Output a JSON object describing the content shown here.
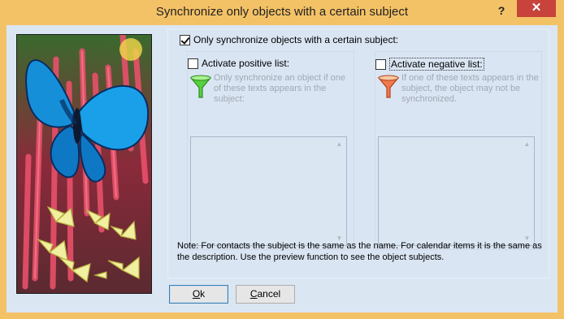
{
  "window": {
    "title": "Synchronize only objects with a certain subject",
    "help_label": "?",
    "close_label": "✕"
  },
  "main_option": {
    "label": "Only synchronize objects with a certain subject:",
    "checked": true
  },
  "positive": {
    "label": "Activate positive list:",
    "checked": false,
    "description": "Only synchronize an object if one of these texts appears in the subject:",
    "icon": "green-funnel-icon"
  },
  "negative": {
    "label": "Activate negative list:",
    "checked": false,
    "description": "If one of these texts appears in the subject, the object may not be synchronized.",
    "icon": "red-funnel-icon"
  },
  "note": "Note: For contacts the subject is the same as the name. For calendar items it is the same as the description.  Use the preview function to see the object subjects.",
  "buttons": {
    "ok_mnemonic": "O",
    "ok_rest": "k",
    "cancel_mnemonic": "C",
    "cancel_rest": "ancel"
  },
  "colors": {
    "title_bar": "#f4c266",
    "close_button": "#c7433b",
    "client_bg": "#dbe6f3"
  },
  "picture": "butterflies-on-red-flowers"
}
